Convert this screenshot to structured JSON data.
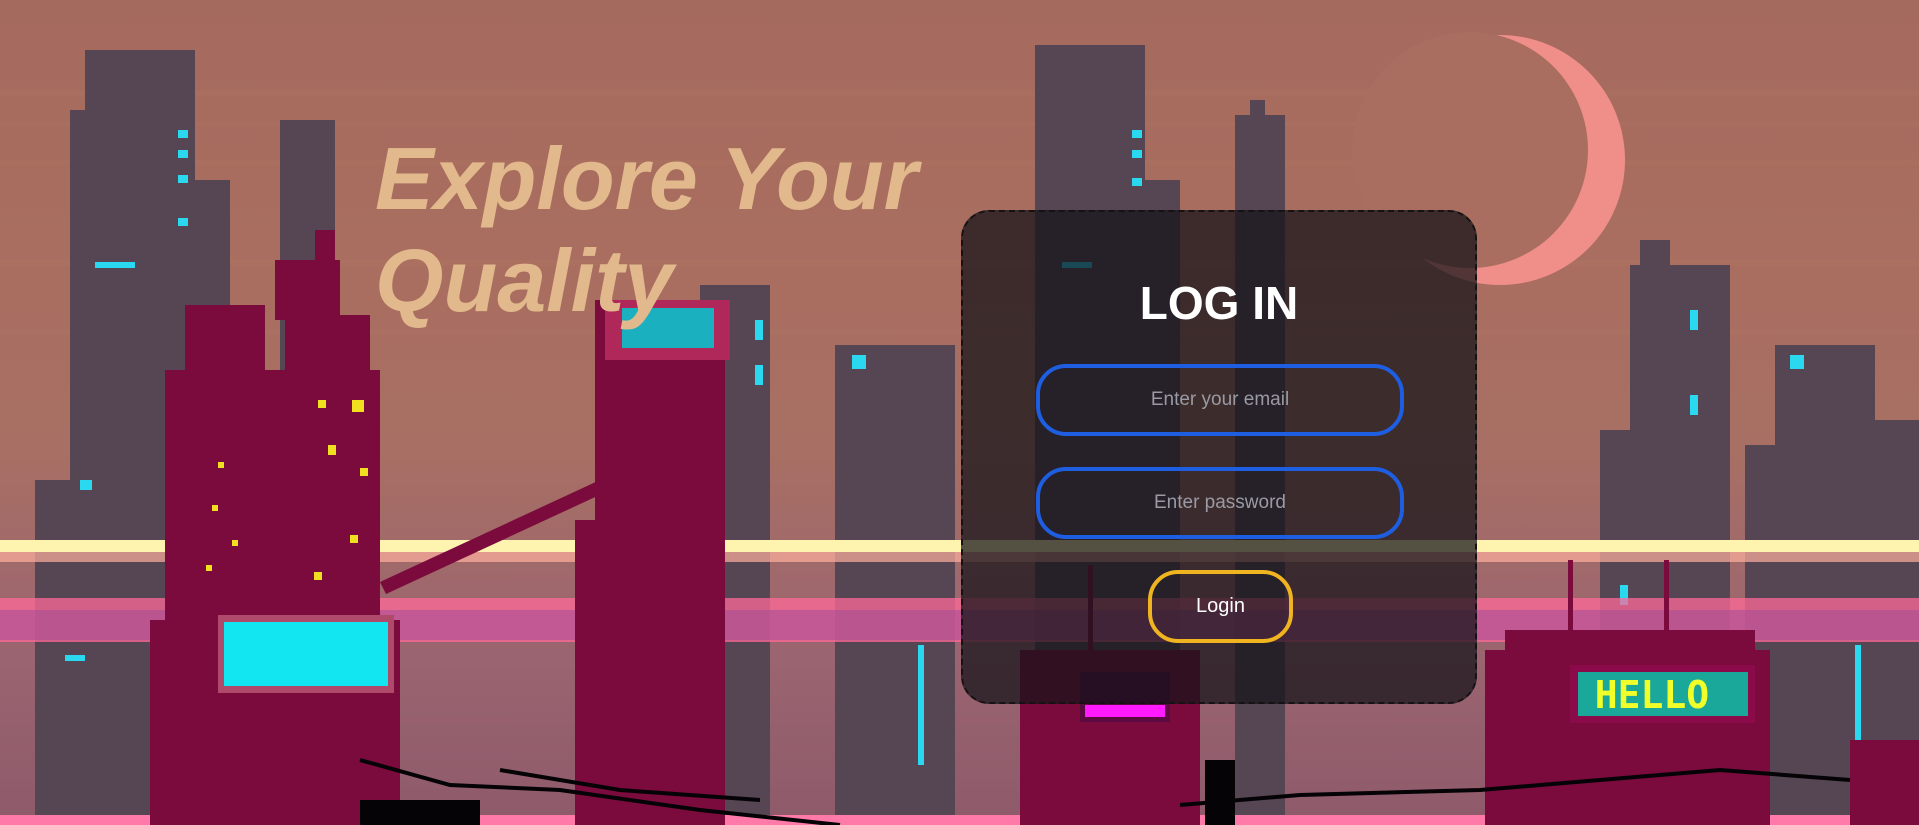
{
  "hero": {
    "headline_line1": "Explore Your",
    "headline_line2": "Quality"
  },
  "login": {
    "title": "LOG IN",
    "email_placeholder": "Enter your email",
    "password_placeholder": "Enter password",
    "button_label": "Login"
  },
  "scene": {
    "sign_text": "HELLO",
    "colors": {
      "sky": "#a56a5e",
      "far_buildings": "#564552",
      "near_buildings": "#7a0b3c",
      "moon": "#f08f8a",
      "neon_cyan": "#12e6f0",
      "neon_pink": "#ff6a9a",
      "sign_text": "#f0ff2a",
      "headline": "#e2b98d",
      "email_border": "#1e5ee0",
      "button_border": "#f0b420"
    }
  }
}
